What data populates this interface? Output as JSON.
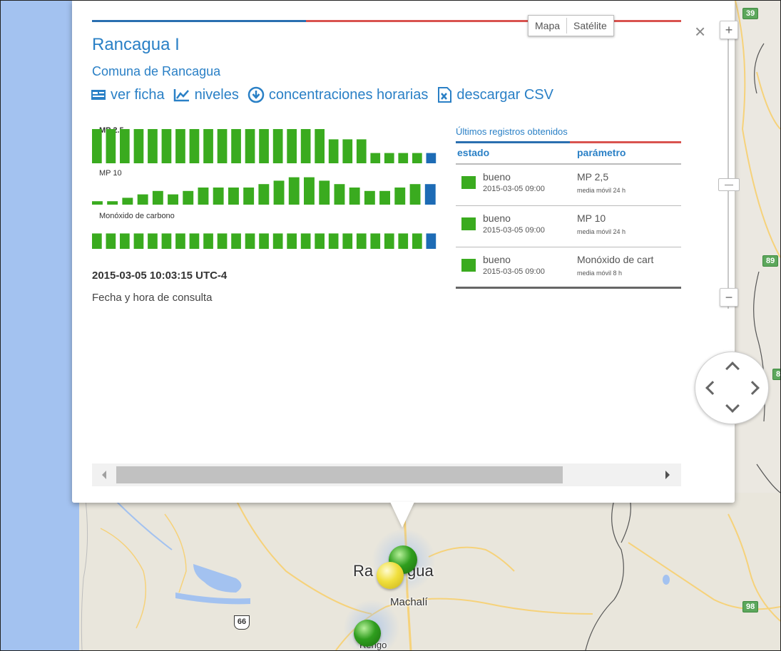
{
  "map": {
    "map_type_buttons": [
      "Mapa",
      "Satélite"
    ],
    "road_shields": [
      "39",
      "89",
      "8",
      "98"
    ],
    "route_66": "66",
    "cities": [
      "Ra",
      "gua",
      "Machalí",
      "Rengo"
    ]
  },
  "controls": {
    "zoom_in": "+",
    "zoom_out": "−",
    "close": "×"
  },
  "station": {
    "name": "Rancagua I",
    "commune": "Comuna de Rancagua",
    "links": [
      "ver ficha",
      "niveles",
      "concentraciones horarias",
      "descargar CSV"
    ]
  },
  "charts": [
    {
      "label": "MP 2.5",
      "values": [
        5,
        5,
        5,
        5,
        5,
        5,
        5,
        5,
        5,
        5,
        5,
        5,
        5,
        5,
        5,
        5,
        5,
        3.5,
        3.5,
        3.5,
        1.5,
        1.5,
        1.5,
        1.5,
        1.5
      ],
      "last_color": "#1d6bb5"
    },
    {
      "label": "MP 10",
      "values": [
        0.5,
        0.5,
        1,
        1.5,
        2,
        1.5,
        2,
        2.5,
        2.5,
        2.5,
        2.5,
        3,
        3.5,
        4,
        4,
        3.5,
        3,
        2.5,
        2,
        2,
        2.5,
        3,
        3
      ],
      "last_color": "#1d6bb5"
    },
    {
      "label": "Monóxido de carbono",
      "values": [
        3,
        3,
        3,
        3,
        3,
        3,
        3,
        3,
        3,
        3,
        3,
        3,
        3,
        3,
        3,
        3,
        3,
        3,
        3,
        3,
        3,
        3,
        3,
        3,
        3
      ],
      "last_color": "#1d6bb5"
    }
  ],
  "bar_color": "#3aab1f",
  "timestamp": "2015-03-05 10:03:15 UTC-4",
  "timestamp_caption": "Fecha y hora de consulta",
  "records": {
    "title": "Últimos registros obtenidos",
    "headers": [
      "estado",
      "parámetro"
    ],
    "rows": [
      {
        "state": "bueno",
        "date": "2015-03-05 09:00",
        "param": "MP 2,5",
        "sub": "media móvil 24 h"
      },
      {
        "state": "bueno",
        "date": "2015-03-05 09:00",
        "param": "MP 10",
        "sub": "media móvil 24 h"
      },
      {
        "state": "bueno",
        "date": "2015-03-05 09:00",
        "param": "Monóxido de cart",
        "sub": "media móvil 8 h"
      }
    ]
  },
  "colors": {
    "accent_blue": "#2a80c6",
    "state_good": "#3aab1f",
    "marker_green": "#2f9e1e",
    "marker_yellow": "#f0df3c"
  }
}
